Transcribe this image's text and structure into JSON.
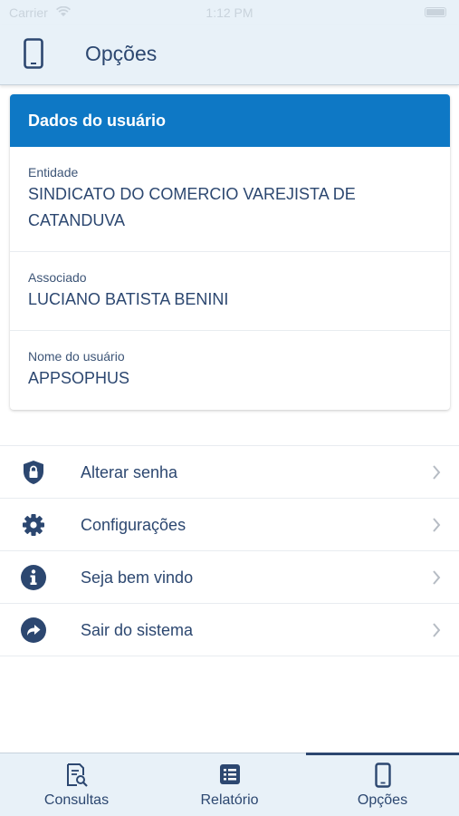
{
  "status_bar": {
    "carrier": "Carrier",
    "time": "1:12 PM"
  },
  "nav": {
    "title": "Opções",
    "icon": "phone-icon"
  },
  "user_card": {
    "header": "Dados do usuário",
    "fields": [
      {
        "label": "Entidade",
        "value_line1": "SINDICATO DO COMERCIO VAREJISTA DE",
        "value_line2": "CATANDUVA"
      },
      {
        "label": "Associado",
        "value": "LUCIANO BATISTA BENINI"
      },
      {
        "label": "Nome do usuário",
        "value": "APPSOPHUS"
      }
    ]
  },
  "menu": [
    {
      "label": "Alterar senha",
      "icon": "shield-lock-icon"
    },
    {
      "label": "Configurações",
      "icon": "gear-icon"
    },
    {
      "label": "Seja bem vindo",
      "icon": "info-icon"
    },
    {
      "label": "Sair do sistema",
      "icon": "share-arrow-icon"
    }
  ],
  "tabs": [
    {
      "label": "Consultas",
      "icon": "document-search-icon",
      "active": false
    },
    {
      "label": "Relatório",
      "icon": "list-icon",
      "active": false
    },
    {
      "label": "Opções",
      "icon": "phone-icon",
      "active": true
    }
  ],
  "colors": {
    "primary": "#0e78c5",
    "text": "#2c4770",
    "bar_bg": "#e8f1f8"
  }
}
